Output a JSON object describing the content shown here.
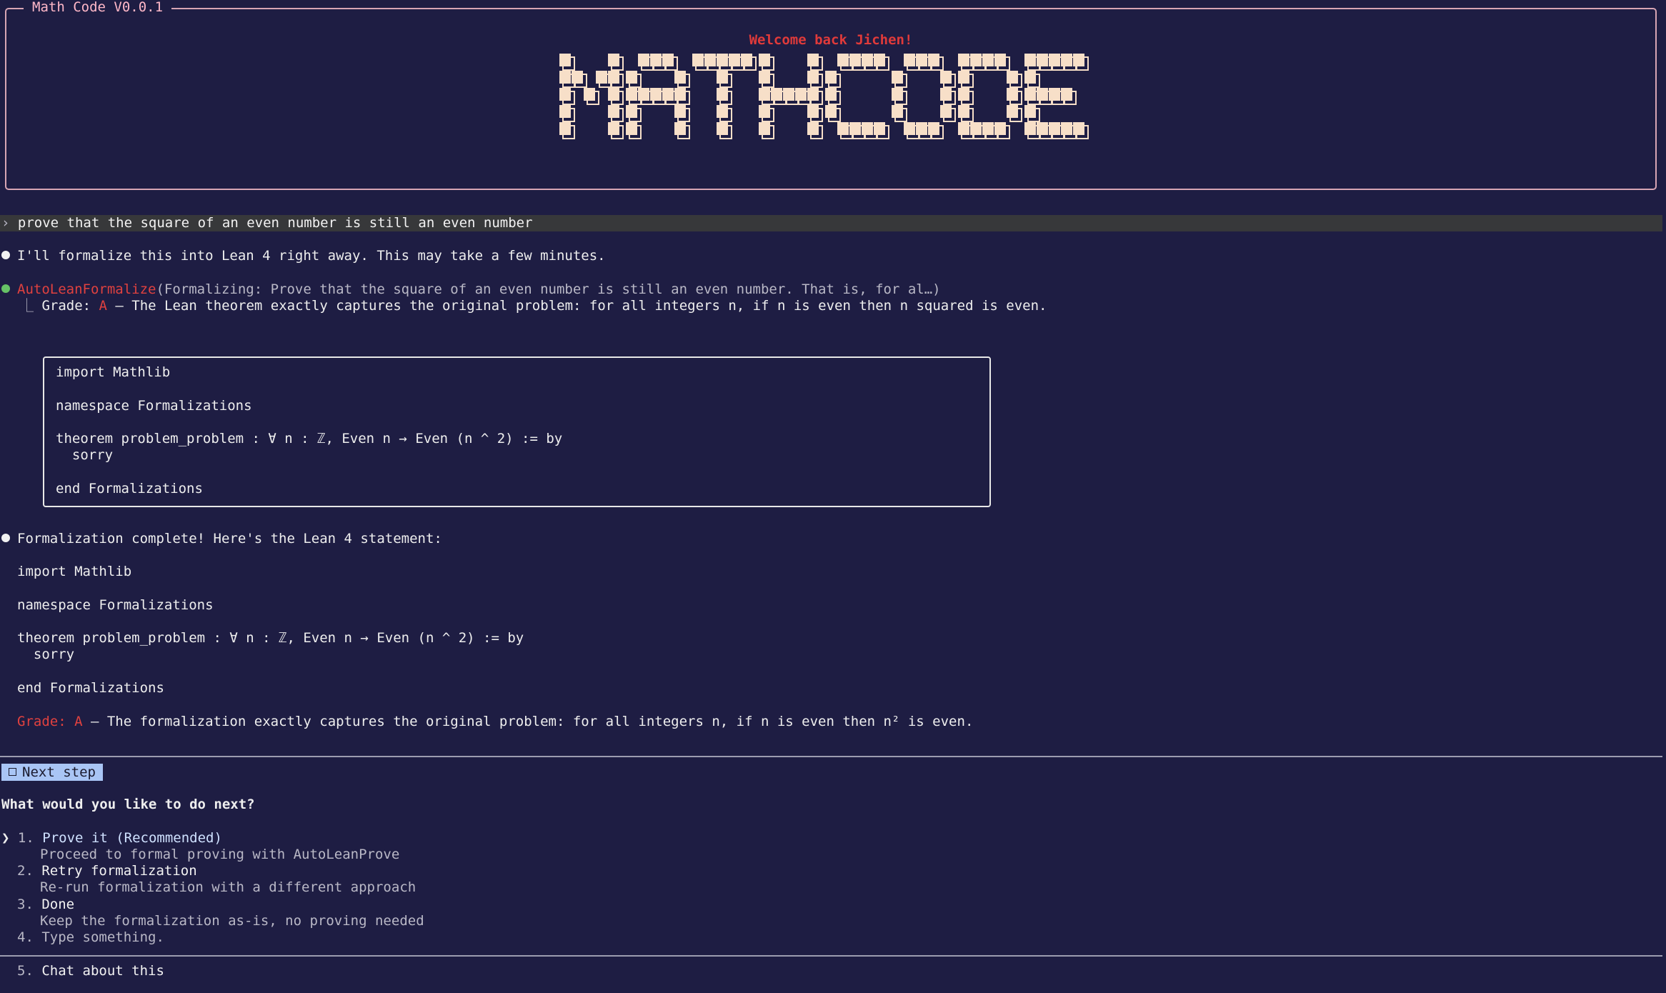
{
  "header": {
    "title": "Math Code V0.0.1",
    "welcome": "Welcome back Jichen!",
    "logo_text": "MATHCODE"
  },
  "colors": {
    "background": "#1e1d43",
    "accent_red": "#e0413f",
    "border_pink": "#d7a5b4",
    "logo_fill": "#f7dfc8",
    "next_step_bg": "#a9c5f5"
  },
  "prompt": {
    "chevron": "›",
    "text": "prove that the square of an even number is still an even number"
  },
  "messages": {
    "intro": "I'll formalize this into Lean 4 right away. This may take a few minutes.",
    "tool_name": "AutoLeanFormalize",
    "tool_args": "(Formalizing: Prove that the square of an even number is still an even number. That is, for al…)",
    "grade_label": "Grade: ",
    "grade_value": "A",
    "grade_desc": " — The Lean theorem exactly captures the original problem: for all integers n, if n is even then n squared is even.",
    "code": [
      "import Mathlib",
      "",
      "namespace Formalizations",
      "",
      "theorem problem_problem : ∀ n : ℤ, Even n → Even (n ^ 2) := by",
      "  sorry",
      "",
      "end Formalizations"
    ],
    "complete": "Formalization complete! Here's the Lean 4 statement:",
    "final_grade_label": "Grade: ",
    "final_grade_value": "A",
    "final_grade_desc": " — The formalization exactly captures the original problem: for all integers n, if n is even then n² is even."
  },
  "next_step": {
    "label": "Next step",
    "question": "What would you like to do next?",
    "cursor": "❯",
    "options": [
      {
        "num": "1.",
        "title": "Prove it (Recommended)",
        "desc": "Proceed to formal proving with AutoLeanProve"
      },
      {
        "num": "2.",
        "title": "Retry formalization",
        "desc": "Re-run formalization with a different approach"
      },
      {
        "num": "3.",
        "title": "Done",
        "desc": "Keep the formalization as-is, no proving needed"
      },
      {
        "num": "4.",
        "title": "Type something.",
        "desc": ""
      }
    ],
    "chat": {
      "num": "5.",
      "title": "Chat about this"
    }
  }
}
